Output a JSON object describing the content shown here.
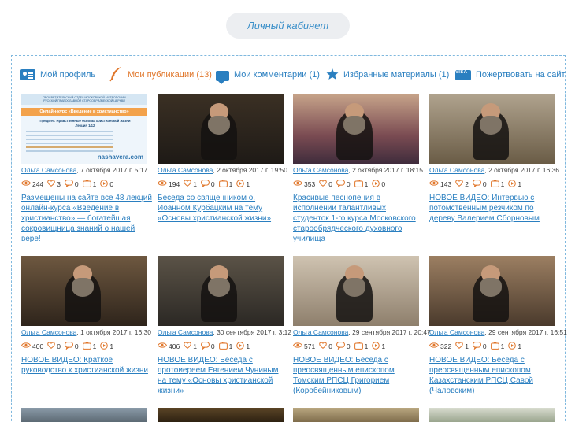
{
  "header": {
    "cabinet_label": "Личный кабинет"
  },
  "nav": [
    {
      "label": "Мой профиль",
      "icon": "profile-icon"
    },
    {
      "label": "Мои публикации (13)",
      "icon": "feather-icon"
    },
    {
      "label": "Мои комментарии (1)",
      "icon": "comment-icon"
    },
    {
      "label": "Избранные материалы (1)",
      "icon": "star-icon"
    },
    {
      "label": "Пожертвовать на сайт",
      "icon": "visa-icon",
      "icon_text": "VISA"
    }
  ],
  "cards": [
    {
      "author": "Ольга Самсонова",
      "date": ", 7 октября 2017 г. 5:17",
      "views": "244",
      "likes": "3",
      "comments": "0",
      "reposts": "1",
      "plays": "0",
      "title": "Размещены на сайте все 48 лекций онлайн-курса «Введение в христианство» — богатейшая сокровищница знаний о нашей вере!",
      "poster": {
        "l1": "ПРОСВЕТИТЕЛЬСКИЙ ОТДЕЛ МОСКОВСКОЙ МИТРОПОЛИИ",
        "l2": "РУССКОЙ ПРАВОСЛАВНОЙ СТАРООБРЯДЧЕСКОЙ ЦЕРКВИ",
        "l3": "Онлайн-курс «Введение в христианство»",
        "l4": "Предмет: Нравственные основы христианской жизни",
        "l5": "Лекция 1/12",
        "site": "nashavera.com"
      }
    },
    {
      "author": "Ольга Самсонова",
      "date": ", 2 октября 2017 г. 19:50",
      "views": "194",
      "likes": "1",
      "comments": "0",
      "reposts": "1",
      "plays": "1",
      "title": "Беседа со священником о. Иоанном Курбацким на тему «Основы христианской жизни»"
    },
    {
      "author": "Ольга Самсонова",
      "date": ", 2 октября 2017 г. 18:15",
      "views": "353",
      "likes": "0",
      "comments": "0",
      "reposts": "1",
      "plays": "0",
      "title": "Красивые песнопения в исполнении талантливых студенток 1-го курса Московского старообрядческого духовного училища"
    },
    {
      "author": "Ольга Самсонова",
      "date": ", 2 октября 2017 г. 16:36",
      "views": "143",
      "likes": "2",
      "comments": "0",
      "reposts": "1",
      "plays": "1",
      "title": "НОВОЕ ВИДЕО: Интервью с потомственным резчиком по дереву Валерием Сборновым"
    },
    {
      "author": "Ольга Самсонова",
      "date": ", 1 октября 2017 г. 16:30",
      "views": "400",
      "likes": "0",
      "comments": "0",
      "reposts": "1",
      "plays": "1",
      "title": "НОВОЕ ВИДЕО: Краткое руководство к христианской жизни"
    },
    {
      "author": "Ольга Самсонова",
      "date": ", 30 сентября 2017 г. 3:12",
      "views": "406",
      "likes": "1",
      "comments": "0",
      "reposts": "1",
      "plays": "1",
      "title": "НОВОЕ ВИДЕО: Беседа с протоиереем Евгением Чуниным на тему «Основы христианской жизни»"
    },
    {
      "author": "Ольга Самсонова",
      "date": ", 29 сентября 2017 г. 20:47",
      "views": "571",
      "likes": "0",
      "comments": "0",
      "reposts": "1",
      "plays": "1",
      "title": "НОВОЕ ВИДЕО: Беседа с преосвященным епископом Томским РПСЦ Григорием (Коробейниковым)"
    },
    {
      "author": "Ольга Самсонова",
      "date": ", 29 сентября 2017 г. 16:51",
      "views": "322",
      "likes": "1",
      "comments": "0",
      "reposts": "1",
      "plays": "1",
      "title": "НОВОЕ ВИДЕО: Беседа с преосвященным епископом Казахстанским РПСЦ Савой (Чаловским)"
    }
  ],
  "colors": {
    "link": "#2a7fc0",
    "active": "#e0762a",
    "frame": "#7fb8de",
    "button_bg": "#eceef1"
  }
}
